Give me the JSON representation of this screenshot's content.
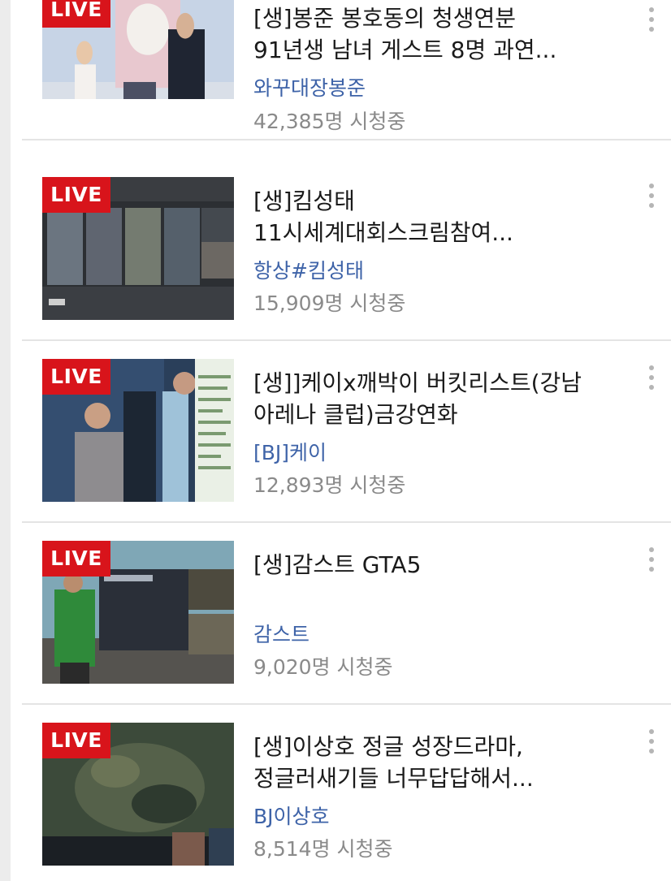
{
  "streams": [
    {
      "live_label": "LIVE",
      "title": "[생]봉준 봉호동의 청생연분\n91년생 남녀 게스트 8명 과연...",
      "channel": "와꾸대장봉준",
      "viewers": "42,385명 시청중",
      "thumbnail": "studio-guests"
    },
    {
      "live_label": "LIVE",
      "title": "[생]킴성태\n11시세계대회스크림참여...",
      "channel": "항상#킴성태",
      "viewers": "15,909명 시청중",
      "thumbnail": "pubg-broadcast"
    },
    {
      "live_label": "LIVE",
      "title": "[생]]케이x깨박이 버킷리스트(강남\n아레나 클럽)금강연화",
      "channel": "[BJ]케이",
      "viewers": "12,893명 시청중",
      "thumbnail": "room-stream-chat"
    },
    {
      "live_label": "LIVE",
      "title": "[생]감스트 GTA5",
      "channel": "감스트",
      "viewers": "9,020명 시청중",
      "thumbnail": "gta5-broadcast"
    },
    {
      "live_label": "LIVE",
      "title": "[생]이상호 정글 성장드라마,\n정글러새기들 너무답답해서...",
      "channel": "BJ이상호",
      "viewers": "8,514명 시청중",
      "thumbnail": "lol-map"
    }
  ],
  "icons": {
    "more": "vertical-ellipsis-icon"
  },
  "colors": {
    "live_badge": "#d8141b",
    "channel_link": "#3e63a8",
    "viewers_text": "#8a8a8a",
    "title_text": "#1a1a1a",
    "divider": "#e4e4e4"
  }
}
